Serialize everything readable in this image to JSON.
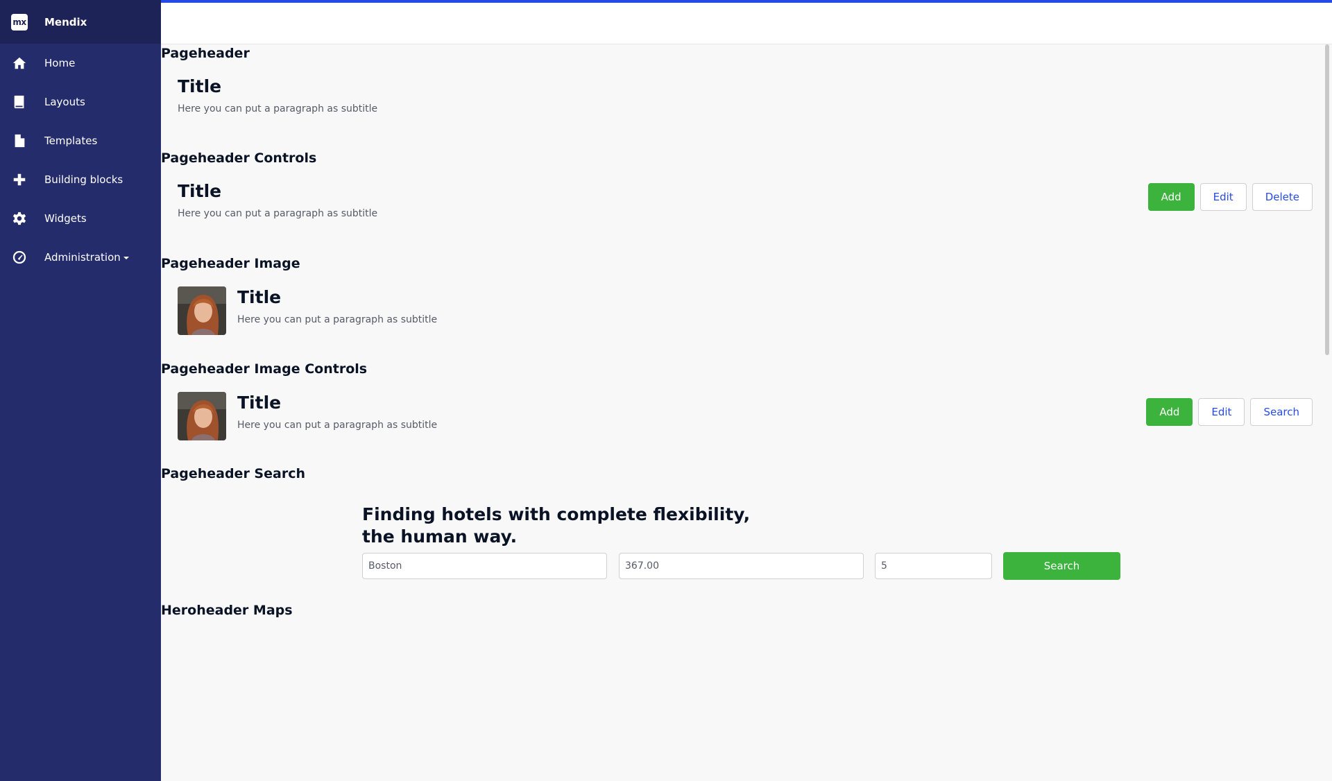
{
  "brand": {
    "logo": "mx",
    "name": "Mendix"
  },
  "nav": [
    {
      "label": "Home",
      "icon": "home-icon"
    },
    {
      "label": "Layouts",
      "icon": "book-icon"
    },
    {
      "label": "Templates",
      "icon": "file-icon"
    },
    {
      "label": "Building blocks",
      "icon": "plus-icon"
    },
    {
      "label": "Widgets",
      "icon": "gear-icon"
    },
    {
      "label": "Administration",
      "icon": "dashboard-icon"
    }
  ],
  "sections": {
    "pageheader": {
      "heading": "Pageheader",
      "title": "Title",
      "subtitle": "Here you can put a paragraph as subtitle"
    },
    "controls": {
      "heading": "Pageheader Controls",
      "title": "Title",
      "subtitle": "Here you can put a paragraph as subtitle",
      "buttons": [
        "Add",
        "Edit",
        "Delete"
      ]
    },
    "image": {
      "heading": "Pageheader Image",
      "title": "Title",
      "subtitle": "Here you can put a paragraph as subtitle"
    },
    "image_controls": {
      "heading": "Pageheader Image Controls",
      "title": "Title",
      "subtitle": "Here you can put a paragraph as subtitle",
      "buttons": [
        "Add",
        "Edit",
        "Search"
      ]
    },
    "search": {
      "heading": "Pageheader Search",
      "line1": "Finding hotels with complete flexibility,",
      "line2": "the human way.",
      "location": "Boston",
      "price": "367.00",
      "guests": "5",
      "button": "Search"
    },
    "maps": {
      "heading": "Heroheader Maps"
    }
  },
  "colors": {
    "sidebar": "#252c6b",
    "brand_bar": "#1d2257",
    "accent": "#264ae5",
    "success": "#3cb33d"
  }
}
